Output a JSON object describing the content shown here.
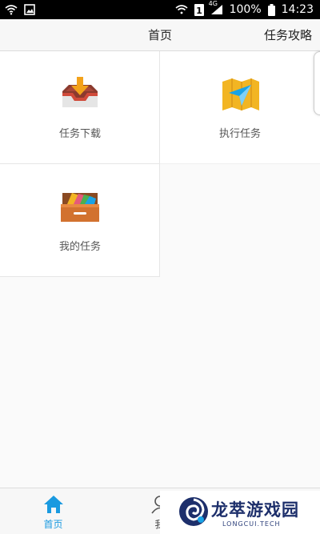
{
  "status_bar": {
    "network": "4G",
    "sim": "1",
    "battery": "100%",
    "time": "14:23",
    "icons": [
      "wifi-icon",
      "image-icon",
      "sim-icon",
      "signal-icon",
      "battery-icon"
    ]
  },
  "header": {
    "title": "首页",
    "action": "任务攻略"
  },
  "grid": [
    {
      "label": "任务下载",
      "icon": "inbox-download-icon"
    },
    {
      "label": "执行任务",
      "icon": "map-navigation-icon"
    },
    {
      "label": "我的任务",
      "icon": "drawer-folder-icon"
    }
  ],
  "bottom_nav": [
    {
      "label": "首页",
      "icon": "home-icon",
      "active": true
    },
    {
      "label": "我",
      "icon": "person-icon",
      "active": false
    }
  ],
  "watermark": {
    "title": "龙萃游戏园",
    "subtitle": "LONGCUI.TECH"
  },
  "colors": {
    "accent": "#1a9ae0",
    "header_bg": "#f7f7f7",
    "status_bg": "#000000"
  }
}
